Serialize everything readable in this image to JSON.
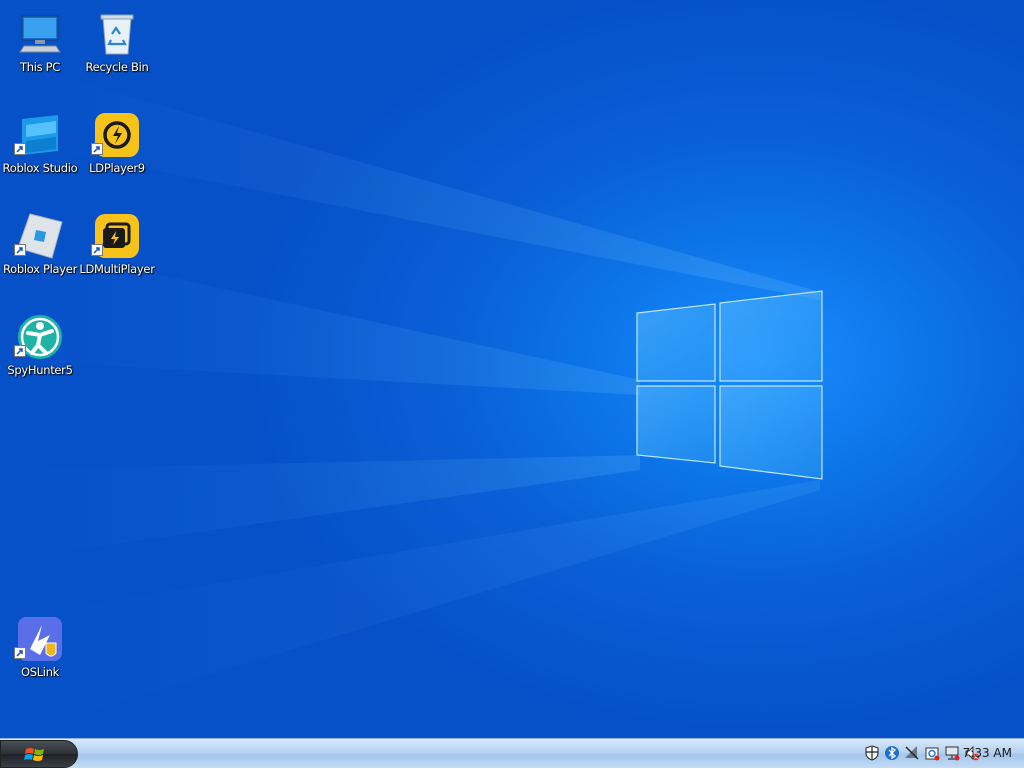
{
  "desktop": {
    "icons": [
      {
        "label": "This PC",
        "icon": "computer-icon"
      },
      {
        "label": "Recycle Bin",
        "icon": "recycle-bin-icon"
      },
      {
        "label": "Roblox Studio",
        "icon": "roblox-studio-icon"
      },
      {
        "label": "LDPlayer9",
        "icon": "ldplayer-icon"
      },
      {
        "label": "Roblox Player",
        "icon": "roblox-player-icon"
      },
      {
        "label": "LDMultiPlayer",
        "icon": "ldmultiplayer-icon"
      },
      {
        "label": "SpyHunter5",
        "icon": "spyhunter-icon"
      },
      {
        "label": "OSLink",
        "icon": "oslink-icon"
      }
    ]
  },
  "taskbar": {
    "start_icon": "windows-orb-icon",
    "tray": {
      "icons": [
        "security-shield-icon",
        "bluetooth-icon",
        "network-disconnected-icon",
        "power-icon",
        "network-icon",
        "volume-muted-icon"
      ],
      "clock": "7:33 AM"
    }
  },
  "colors": {
    "wallpaper": "#0a66dc",
    "taskbar": "#b6d3f1",
    "ldplayer_yellow": "#f7c31a"
  }
}
